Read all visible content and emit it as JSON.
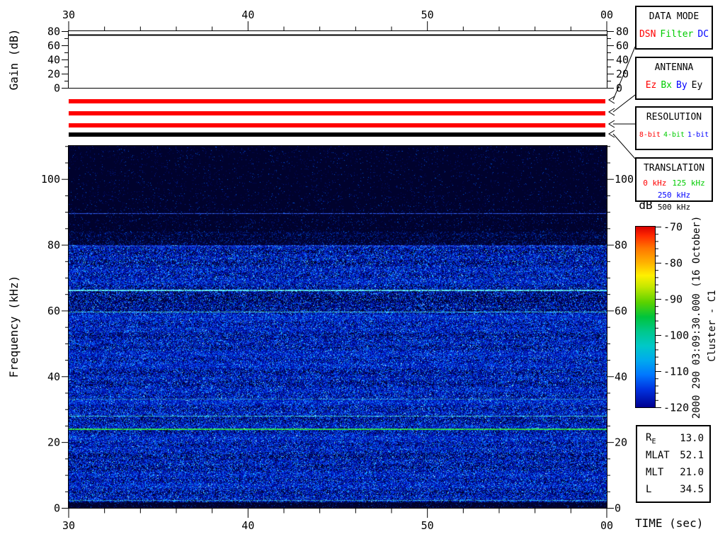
{
  "meta": {
    "spacecraft": "Cluster - C1",
    "datetime_label": "2000 290 03:09:30.000 (16 October)"
  },
  "panels": {
    "data_mode": {
      "title": "DATA MODE",
      "options": [
        {
          "label": "DSN",
          "color": "#ff0000"
        },
        {
          "label": "Filter",
          "color": "#00cc00"
        },
        {
          "label": "DC",
          "color": "#0000ff"
        }
      ]
    },
    "antenna": {
      "title": "ANTENNA",
      "options": [
        {
          "label": "Ez",
          "color": "#ff0000"
        },
        {
          "label": "Bx",
          "color": "#00cc00"
        },
        {
          "label": "By",
          "color": "#0000ff"
        },
        {
          "label": "Ey",
          "color": "#000000"
        }
      ]
    },
    "resolution": {
      "title": "RESOLUTION",
      "options": [
        {
          "label": "8-bit",
          "color": "#ff0000"
        },
        {
          "label": "4-bit",
          "color": "#00cc00"
        },
        {
          "label": "1-bit",
          "color": "#0000ff"
        }
      ]
    },
    "translation": {
      "title": "TRANSLATION",
      "options": [
        {
          "label": "0 kHz",
          "color": "#ff0000"
        },
        {
          "label": "125 kHz",
          "color": "#00cc00"
        },
        {
          "label": "250 kHz",
          "color": "#0000ff"
        },
        {
          "label": "500 kHz",
          "color": "#000000"
        }
      ]
    }
  },
  "status_bars": [
    {
      "panel": "DATA MODE",
      "active": "DSN",
      "color": "#ff0000"
    },
    {
      "panel": "ANTENNA",
      "active": "Ez",
      "color": "#ff0000"
    },
    {
      "panel": "RESOLUTION",
      "active": "8-bit",
      "color": "#ff0000"
    },
    {
      "panel": "TRANSLATION",
      "active": "500 kHz",
      "color": "#000000"
    }
  ],
  "ephemeris": {
    "rows": [
      {
        "label": "R",
        "subscript": "E",
        "value": "13.0"
      },
      {
        "label": "MLAT",
        "value": "52.1"
      },
      {
        "label": "MLT",
        "value": "21.0"
      },
      {
        "label": "L",
        "value": "34.5"
      }
    ]
  },
  "chart_data": [
    {
      "type": "line",
      "name": "receiver-gain",
      "ylabel": "Gain (dB)",
      "ylim": [
        0,
        80
      ],
      "yticks": [
        0,
        20,
        40,
        60,
        80
      ],
      "ytick_minor_step": 10,
      "x_ticks": [
        "30",
        "40",
        "50",
        "00"
      ],
      "x_major_step_sec": 10,
      "x_minor_step_sec": 2,
      "series": [
        {
          "name": "gain",
          "style": "constant",
          "value_db": 75
        }
      ]
    },
    {
      "type": "heatmap",
      "name": "spectrogram",
      "xlabel": "TIME (sec)",
      "ylabel": "Frequency (kHz)",
      "x_ticks": [
        "30",
        "40",
        "50",
        "00"
      ],
      "x_major_step_sec": 10,
      "x_minor_step_sec": 2,
      "ylim_khz": [
        0,
        110
      ],
      "yticks": [
        0,
        20,
        40,
        60,
        80,
        100
      ],
      "ytick_minor_step": 5,
      "colorbar": {
        "title": "dB",
        "lim": [
          -70,
          -120
        ],
        "ticks": [
          -70,
          -80,
          -90,
          -100,
          -110,
          -120
        ],
        "minor_step_db": 2,
        "gradient_stops": [
          {
            "pos": 0.0,
            "color": "#d80000"
          },
          {
            "pos": 0.05,
            "color": "#ff2a00"
          },
          {
            "pos": 0.12,
            "color": "#ff7700"
          },
          {
            "pos": 0.2,
            "color": "#ffb300"
          },
          {
            "pos": 0.27,
            "color": "#fff000"
          },
          {
            "pos": 0.33,
            "color": "#c8e800"
          },
          {
            "pos": 0.42,
            "color": "#5ad200"
          },
          {
            "pos": 0.5,
            "color": "#00c43c"
          },
          {
            "pos": 0.58,
            "color": "#00c88c"
          },
          {
            "pos": 0.66,
            "color": "#00c8c8"
          },
          {
            "pos": 0.74,
            "color": "#00aaee"
          },
          {
            "pos": 0.82,
            "color": "#0077ff"
          },
          {
            "pos": 0.9,
            "color": "#0033e0"
          },
          {
            "pos": 1.0,
            "color": "#000090"
          }
        ]
      },
      "background": "#00022d",
      "noise_bands": [
        {
          "f_lo": 0.0,
          "f_hi": 1.8,
          "density": 0.15
        },
        {
          "f_lo": 1.8,
          "f_hi": 24.0,
          "density": 0.82
        },
        {
          "f_lo": 24.0,
          "f_hi": 59.8,
          "density": 0.85
        },
        {
          "f_lo": 59.8,
          "f_hi": 66.0,
          "density": 0.62
        },
        {
          "f_lo": 66.0,
          "f_hi": 80.0,
          "density": 0.8
        },
        {
          "f_lo": 80.0,
          "f_hi": 84.0,
          "density": 0.28
        },
        {
          "f_lo": 84.0,
          "f_hi": 91.0,
          "density": 0.09
        },
        {
          "f_lo": 91.0,
          "f_hi": 110.1,
          "density": 0.05
        }
      ],
      "spectral_lines": [
        {
          "f_khz": 89.4,
          "color": "#2a4fe0",
          "px": 1,
          "speckle": 0.5
        },
        {
          "f_khz": 79.5,
          "color": "#2548c8",
          "px": 1,
          "speckle": 0.55
        },
        {
          "f_khz": 66.2,
          "color": "#55d8ee",
          "px": 2,
          "speckle": 0.25
        },
        {
          "f_khz": 59.5,
          "color": "#3fc4e0",
          "px": 1,
          "speckle": 0.3
        },
        {
          "f_khz": 33.0,
          "color": "#2a85c8",
          "px": 1,
          "speckle": 0.55
        },
        {
          "f_khz": 27.8,
          "color": "#40c8d0",
          "px": 1,
          "speckle": 0.35
        },
        {
          "f_khz": 23.8,
          "color": "#2fd24a",
          "px": 2,
          "speckle": 0.08
        },
        {
          "f_khz": 2.2,
          "color": "#2f9fd8",
          "px": 1,
          "speckle": 0.5
        }
      ]
    }
  ]
}
